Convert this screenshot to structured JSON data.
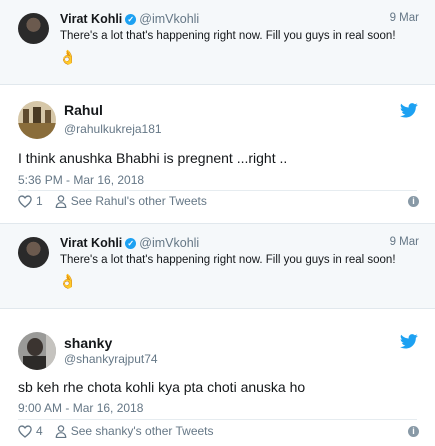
{
  "tweets": [
    {
      "quoted": {
        "name": "Virat Kohli",
        "handle": "@imVkohli",
        "date": "9 Mar",
        "text": "There's a lot that's happening right now. Fill you guys in real soon!",
        "emoji": "👌"
      },
      "name": "Rahul",
      "handle": "@rahulkukreja181",
      "text": "I think anushka Bhabhi is pregnent  ...right ..",
      "time": "5:36 PM - Mar 16, 2018",
      "likes": "1",
      "profile_link": "See Rahul's other Tweets"
    },
    {
      "quoted": {
        "name": "Virat Kohli",
        "handle": "@imVkohli",
        "date": "9 Mar",
        "text": "There's a lot that's happening right now. Fill you guys in real soon!",
        "emoji": "👌"
      },
      "name": "shanky",
      "handle": "@shankyrajput74",
      "text": "sb keh rhe chota kohli kya pta choti anuska ho",
      "time": "9:00 AM - Mar 16, 2018",
      "likes": "4",
      "profile_link": "See shanky's other Tweets"
    }
  ],
  "colors": {
    "twitter_blue": "#1da1f2",
    "secondary_text": "#657786",
    "quoted_bg": "#f5f8fa"
  },
  "icons": [
    "verified-badge-icon",
    "twitter-bird-icon",
    "heart-icon",
    "person-icon",
    "info-icon"
  ]
}
